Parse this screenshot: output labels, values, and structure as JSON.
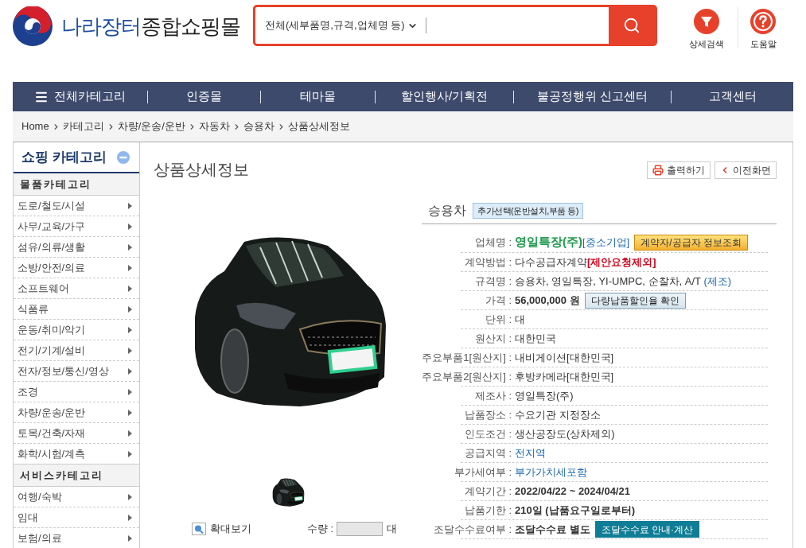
{
  "header": {
    "logo": {
      "brand": "나라장터",
      "suffix": "종합쇼핑몰"
    },
    "search": {
      "scope": "전체(세부품명,규격,업체명 등)"
    },
    "tools": [
      {
        "label": "상세검색",
        "kind": "filter"
      },
      {
        "label": "도움말",
        "kind": "help"
      }
    ]
  },
  "nav": [
    {
      "label": "전체카테고리",
      "kind": "menu"
    },
    {
      "label": "인증몰",
      "kind": "link"
    },
    {
      "label": "테마몰",
      "kind": "link"
    },
    {
      "label": "할인행사/기획전",
      "kind": "link"
    },
    {
      "label": "불공정행위 신고센터",
      "kind": "link"
    },
    {
      "label": "고객센터",
      "kind": "link"
    }
  ],
  "breadcrumb": [
    "Home",
    "카테고리",
    "차량/운송/운반",
    "자동차",
    "승용차",
    "상품상세정보"
  ],
  "sidebar": {
    "title": "쇼핑 카테고리",
    "expanded": true,
    "sections": [
      {
        "title": "물품카테고리",
        "items": [
          "도로/철도/시설",
          "사무/교육/가구",
          "섬유/의류/생활",
          "소방/안전/의료",
          "소프트웨어",
          "식품류",
          "운동/취미/악기",
          "전기/기계/설비",
          "전자/정보/통신/영상",
          "조경",
          "차량/운송/운반",
          "토목/건축/자재",
          "화학/시험/계측"
        ]
      },
      {
        "title": "서비스카테고리",
        "items": [
          "여행/숙박",
          "임대",
          "보험/의료"
        ]
      }
    ]
  },
  "page": {
    "title": "상품상세정보",
    "actions": [
      {
        "label": "출력하기",
        "kind": "print"
      },
      {
        "label": "이전화면",
        "kind": "back"
      }
    ]
  },
  "gallery": {
    "zoom_label": "확대보기",
    "quantity_label": "수량 :",
    "quantity_unit": "대"
  },
  "product": {
    "name": "승용차",
    "option_button": "추가선택(운반설치,부품 등)",
    "rows": [
      {
        "label": "업체명 :",
        "value": [
          {
            "text": "영일특장(주)",
            "kind": "company"
          },
          {
            "text": "[중소기업]",
            "kind": "link"
          }
        ],
        "button": {
          "label": "계약자/공급자 정보조회",
          "kind": "lookup"
        }
      },
      {
        "label": "계약방법 :",
        "value": [
          {
            "text": "다수공급자계약",
            "kind": "text"
          },
          {
            "text": "[제안요청제외]",
            "kind": "notice"
          }
        ]
      },
      {
        "label": "규격명 :",
        "value": [
          {
            "text": "승용차, 영일특장, YI-UMPC, 순찰차, A/T ",
            "kind": "text"
          },
          {
            "text": "(제조)",
            "kind": "link"
          }
        ]
      },
      {
        "label": "가격 :",
        "value": [
          {
            "text": "56,000,000 원",
            "kind": "emphasis"
          }
        ],
        "button": {
          "label": "다량납품할인율 확인",
          "kind": "discount"
        }
      },
      {
        "label": "단위 :",
        "value": [
          {
            "text": "대",
            "kind": "text"
          }
        ]
      },
      {
        "label": "원산지 :",
        "value": [
          {
            "text": "대한민국",
            "kind": "text"
          }
        ]
      },
      {
        "label": "주요부품1[원산지] :",
        "value": [
          {
            "text": "내비게이션[대한민국]",
            "kind": "text"
          }
        ]
      },
      {
        "label": "주요부품2[원산지] :",
        "value": [
          {
            "text": "후방카메라[대한민국]",
            "kind": "text"
          }
        ]
      },
      {
        "label": "제조사 :",
        "value": [
          {
            "text": "영일특장(주)",
            "kind": "text"
          }
        ]
      },
      {
        "label": "납품장소 :",
        "value": [
          {
            "text": "수요기관 지정장소",
            "kind": "text"
          }
        ]
      },
      {
        "label": "인도조건 :",
        "value": [
          {
            "text": "생산공장도(상차제외)",
            "kind": "text"
          }
        ]
      },
      {
        "label": "공급지역 :",
        "value": [
          {
            "text": "전지역",
            "kind": "link"
          }
        ]
      },
      {
        "label": "부가세여부 :",
        "value": [
          {
            "text": "부가가치세포함",
            "kind": "link"
          }
        ]
      },
      {
        "label": "계약기간 :",
        "value": [
          {
            "text": "2022/04/22 ~ 2024/04/21",
            "kind": "emphasis"
          }
        ]
      },
      {
        "label": "납품기한 :",
        "value": [
          {
            "text": "210일 (납품요구일로부터)",
            "kind": "emphasis"
          }
        ]
      },
      {
        "label": "조달수수료여부 :",
        "value": [
          {
            "text": "조달수수료 별도",
            "kind": "emphasis"
          }
        ],
        "button": {
          "label": "조달수수료 안내·계산",
          "kind": "fee"
        }
      }
    ]
  }
}
